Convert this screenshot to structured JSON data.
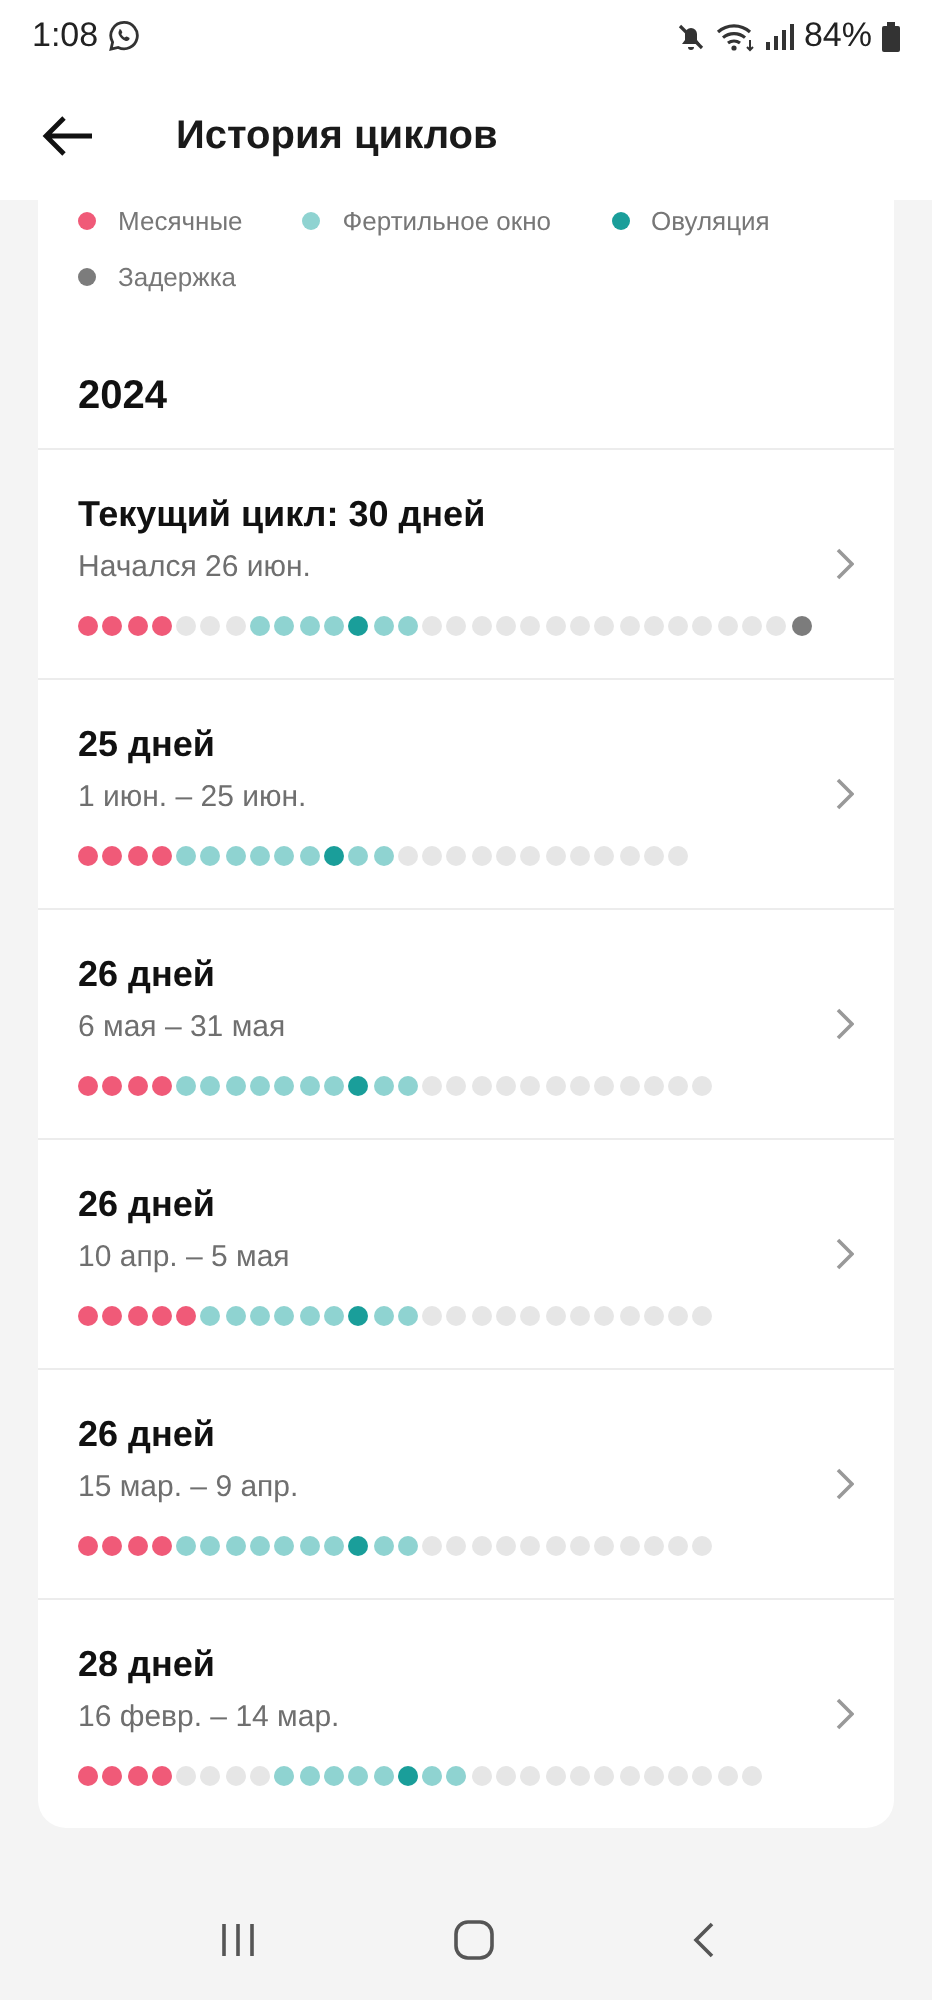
{
  "status_bar": {
    "time": "1:08",
    "battery": "84%"
  },
  "header": {
    "title": "История циклов"
  },
  "legend": [
    {
      "kind": "period",
      "label": "Месячные",
      "color": "#f05a78"
    },
    {
      "kind": "fertile",
      "label": "Фертильное окно",
      "color": "#8fd3d1"
    },
    {
      "kind": "ovulation",
      "label": "Овуляция",
      "color": "#1a9e9a"
    },
    {
      "kind": "delay",
      "label": "Задержка",
      "color": "#7c7c7c"
    }
  ],
  "year": "2024",
  "cycles": [
    {
      "title": "Текущий цикл: 30 дней",
      "dates": "Начался 26 июн.",
      "days": [
        {
          "kind": "period"
        },
        {
          "kind": "period"
        },
        {
          "kind": "period"
        },
        {
          "kind": "period"
        },
        {
          "kind": "none"
        },
        {
          "kind": "none"
        },
        {
          "kind": "none"
        },
        {
          "kind": "fertile"
        },
        {
          "kind": "fertile"
        },
        {
          "kind": "fertile"
        },
        {
          "kind": "fertile"
        },
        {
          "kind": "ovulation"
        },
        {
          "kind": "fertile"
        },
        {
          "kind": "fertile"
        },
        {
          "kind": "none"
        },
        {
          "kind": "none"
        },
        {
          "kind": "none"
        },
        {
          "kind": "none"
        },
        {
          "kind": "none"
        },
        {
          "kind": "none"
        },
        {
          "kind": "none"
        },
        {
          "kind": "none"
        },
        {
          "kind": "none"
        },
        {
          "kind": "none"
        },
        {
          "kind": "none"
        },
        {
          "kind": "none"
        },
        {
          "kind": "none"
        },
        {
          "kind": "none"
        },
        {
          "kind": "none"
        },
        {
          "kind": "delay"
        }
      ]
    },
    {
      "title": "25 дней",
      "dates": "1 июн. – 25 июн.",
      "days": [
        {
          "kind": "period"
        },
        {
          "kind": "period"
        },
        {
          "kind": "period"
        },
        {
          "kind": "period"
        },
        {
          "kind": "fertile"
        },
        {
          "kind": "fertile"
        },
        {
          "kind": "fertile"
        },
        {
          "kind": "fertile"
        },
        {
          "kind": "fertile"
        },
        {
          "kind": "fertile"
        },
        {
          "kind": "ovulation"
        },
        {
          "kind": "fertile"
        },
        {
          "kind": "fertile"
        },
        {
          "kind": "none"
        },
        {
          "kind": "none"
        },
        {
          "kind": "none"
        },
        {
          "kind": "none"
        },
        {
          "kind": "none"
        },
        {
          "kind": "none"
        },
        {
          "kind": "none"
        },
        {
          "kind": "none"
        },
        {
          "kind": "none"
        },
        {
          "kind": "none"
        },
        {
          "kind": "none"
        },
        {
          "kind": "none"
        }
      ]
    },
    {
      "title": "26 дней",
      "dates": "6 мая – 31 мая",
      "days": [
        {
          "kind": "period"
        },
        {
          "kind": "period"
        },
        {
          "kind": "period"
        },
        {
          "kind": "period"
        },
        {
          "kind": "fertile"
        },
        {
          "kind": "fertile"
        },
        {
          "kind": "fertile"
        },
        {
          "kind": "fertile"
        },
        {
          "kind": "fertile"
        },
        {
          "kind": "fertile"
        },
        {
          "kind": "fertile"
        },
        {
          "kind": "ovulation"
        },
        {
          "kind": "fertile"
        },
        {
          "kind": "fertile"
        },
        {
          "kind": "none"
        },
        {
          "kind": "none"
        },
        {
          "kind": "none"
        },
        {
          "kind": "none"
        },
        {
          "kind": "none"
        },
        {
          "kind": "none"
        },
        {
          "kind": "none"
        },
        {
          "kind": "none"
        },
        {
          "kind": "none"
        },
        {
          "kind": "none"
        },
        {
          "kind": "none"
        },
        {
          "kind": "none"
        }
      ]
    },
    {
      "title": "26 дней",
      "dates": "10 апр. – 5 мая",
      "days": [
        {
          "kind": "period"
        },
        {
          "kind": "period"
        },
        {
          "kind": "period"
        },
        {
          "kind": "period"
        },
        {
          "kind": "period"
        },
        {
          "kind": "fertile"
        },
        {
          "kind": "fertile"
        },
        {
          "kind": "fertile"
        },
        {
          "kind": "fertile"
        },
        {
          "kind": "fertile"
        },
        {
          "kind": "fertile"
        },
        {
          "kind": "ovulation"
        },
        {
          "kind": "fertile"
        },
        {
          "kind": "fertile"
        },
        {
          "kind": "none"
        },
        {
          "kind": "none"
        },
        {
          "kind": "none"
        },
        {
          "kind": "none"
        },
        {
          "kind": "none"
        },
        {
          "kind": "none"
        },
        {
          "kind": "none"
        },
        {
          "kind": "none"
        },
        {
          "kind": "none"
        },
        {
          "kind": "none"
        },
        {
          "kind": "none"
        },
        {
          "kind": "none"
        }
      ]
    },
    {
      "title": "26 дней",
      "dates": "15 мар. – 9 апр.",
      "days": [
        {
          "kind": "period"
        },
        {
          "kind": "period"
        },
        {
          "kind": "period"
        },
        {
          "kind": "period"
        },
        {
          "kind": "fertile"
        },
        {
          "kind": "fertile"
        },
        {
          "kind": "fertile"
        },
        {
          "kind": "fertile"
        },
        {
          "kind": "fertile"
        },
        {
          "kind": "fertile"
        },
        {
          "kind": "fertile"
        },
        {
          "kind": "ovulation"
        },
        {
          "kind": "fertile"
        },
        {
          "kind": "fertile"
        },
        {
          "kind": "none"
        },
        {
          "kind": "none"
        },
        {
          "kind": "none"
        },
        {
          "kind": "none"
        },
        {
          "kind": "none"
        },
        {
          "kind": "none"
        },
        {
          "kind": "none"
        },
        {
          "kind": "none"
        },
        {
          "kind": "none"
        },
        {
          "kind": "none"
        },
        {
          "kind": "none"
        },
        {
          "kind": "none"
        }
      ]
    },
    {
      "title": "28 дней",
      "dates": "16 февр. – 14 мар.",
      "days": [
        {
          "kind": "period"
        },
        {
          "kind": "period"
        },
        {
          "kind": "period"
        },
        {
          "kind": "period"
        },
        {
          "kind": "none"
        },
        {
          "kind": "none"
        },
        {
          "kind": "none"
        },
        {
          "kind": "none"
        },
        {
          "kind": "fertile"
        },
        {
          "kind": "fertile"
        },
        {
          "kind": "fertile"
        },
        {
          "kind": "fertile"
        },
        {
          "kind": "fertile"
        },
        {
          "kind": "ovulation"
        },
        {
          "kind": "fertile"
        },
        {
          "kind": "fertile"
        },
        {
          "kind": "none"
        },
        {
          "kind": "none"
        },
        {
          "kind": "none"
        },
        {
          "kind": "none"
        },
        {
          "kind": "none"
        },
        {
          "kind": "none"
        },
        {
          "kind": "none"
        },
        {
          "kind": "none"
        },
        {
          "kind": "none"
        },
        {
          "kind": "none"
        },
        {
          "kind": "none"
        },
        {
          "kind": "none"
        }
      ]
    }
  ]
}
